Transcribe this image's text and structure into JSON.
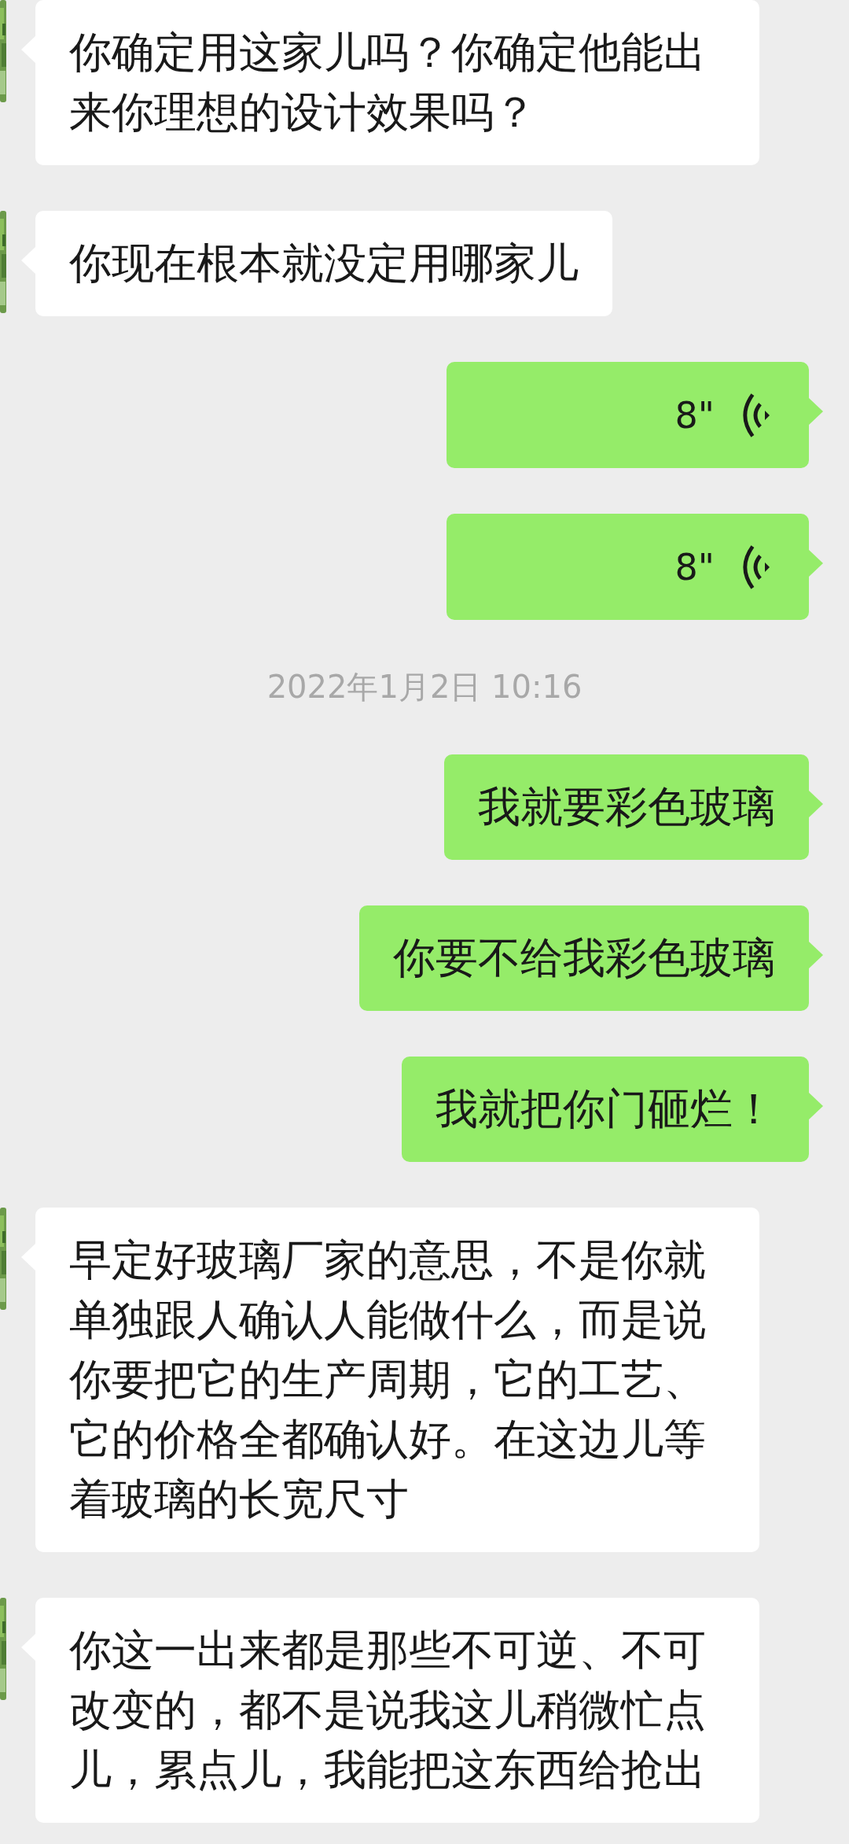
{
  "messages": [
    {
      "kind": "text",
      "outgoing": false,
      "text": "你确定用这家儿吗？你确定他能出来你理想的设计效果吗？"
    },
    {
      "kind": "text",
      "outgoing": false,
      "text": "你现在根本就没定用哪家儿"
    },
    {
      "kind": "voice",
      "outgoing": true,
      "text": "8\""
    },
    {
      "kind": "voice",
      "outgoing": true,
      "text": "8\""
    },
    {
      "kind": "time",
      "text": "2022年1月2日 10:16"
    },
    {
      "kind": "text",
      "outgoing": true,
      "text": "我就要彩色玻璃"
    },
    {
      "kind": "text",
      "outgoing": true,
      "text": "你要不给我彩色玻璃"
    },
    {
      "kind": "text",
      "outgoing": true,
      "text": "我就把你门砸烂！"
    },
    {
      "kind": "text",
      "outgoing": false,
      "text": "早定好玻璃厂家的意思，不是你就单独跟人确认人能做什么，而是说你要把它的生产周期，它的工艺、它的价格全都确认好。在这边儿等着玻璃的长宽尺寸"
    },
    {
      "kind": "text",
      "outgoing": false,
      "text": "你这一出来都是那些不可逆、不可改变的，都不是说我这儿稍微忙点儿，累点儿，我能把这东西给抢出"
    }
  ]
}
